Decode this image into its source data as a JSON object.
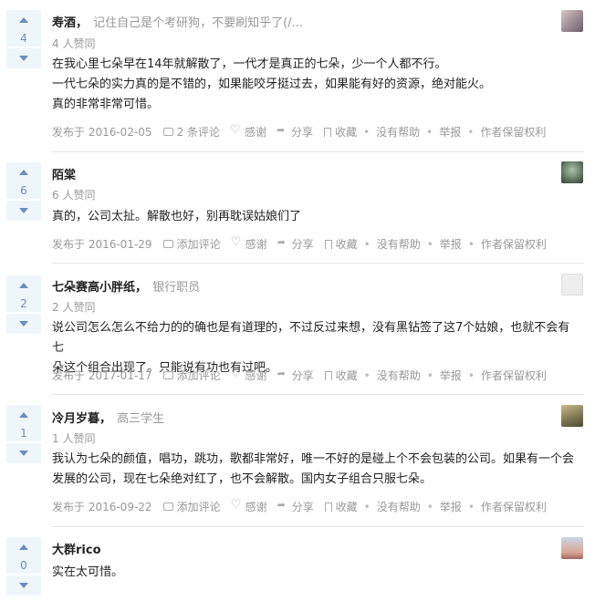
{
  "answers": [
    {
      "votes": "4",
      "author": "寿酒",
      "bio": "记住自己是个考研狗，不要刷知乎了(/...",
      "likes": "4 人赞同",
      "content": [
        "在我心里七朵早在14年就解散了，一代才是真正的七朵，少一个人都不行。",
        "一代七朵的实力真的是不错的，如果能咬牙挺过去，如果能有好的资源，绝对能火。",
        "真的非常非常可惜。"
      ],
      "date": "发布于 2016-02-05",
      "comment": "2 条评论",
      "avatar_colors": [
        "#d9c6c9",
        "#6b5b66"
      ]
    },
    {
      "votes": "6",
      "author": "陌棠",
      "bio": "",
      "likes": "6 人赞同",
      "content": [
        "真的，公司太扯。解散也好，别再耽误姑娘们了"
      ],
      "date": "发布于 2016-01-29",
      "comment": "添加评论",
      "avatar_colors": [
        "#7ea386",
        "#2f3b33"
      ]
    },
    {
      "votes": "2",
      "author": "七朵赛高小胖纸",
      "bio": "银行职员",
      "likes": "2 人赞同",
      "content": [
        "说公司怎么怎么不给力的的确也是有道理的，不过反过来想，没有黑钻签了这7个姑娘，也就不会有七",
        "朵这个组合出现了。只能说有功也有过吧。"
      ],
      "date": "发布于 2017-01-17",
      "comment": "添加评论",
      "avatar_colors": [
        "#eeeeee",
        "#cccccc"
      ]
    },
    {
      "votes": "1",
      "author": "冷月岁暮",
      "bio": "高三学生",
      "likes": "1 人赞同",
      "content": [
        "我认为七朵的颜值，唱功，跳功，歌都非常好，唯一不好的是碰上个不会包装的公司。如果有一个会",
        "发展的公司，现在七朵绝对红了，也不会解散。国内女子组合只服七朵。"
      ],
      "date": "发布于 2016-09-22",
      "comment": "添加评论",
      "avatar_colors": [
        "#b4a373",
        "#5d5a3e"
      ]
    },
    {
      "votes": "0",
      "author": "大群rico",
      "bio": "",
      "likes": "",
      "content": [
        "实在太可惜。"
      ],
      "date": "",
      "comment": "",
      "avatar_colors": [
        "#c8d7e6",
        "#a0645a"
      ]
    }
  ],
  "actions": {
    "thanks": "感谢",
    "share": "分享",
    "collect": "收藏",
    "unhelpful": "没有帮助",
    "report": "举报",
    "rights": "作者保留权利"
  }
}
